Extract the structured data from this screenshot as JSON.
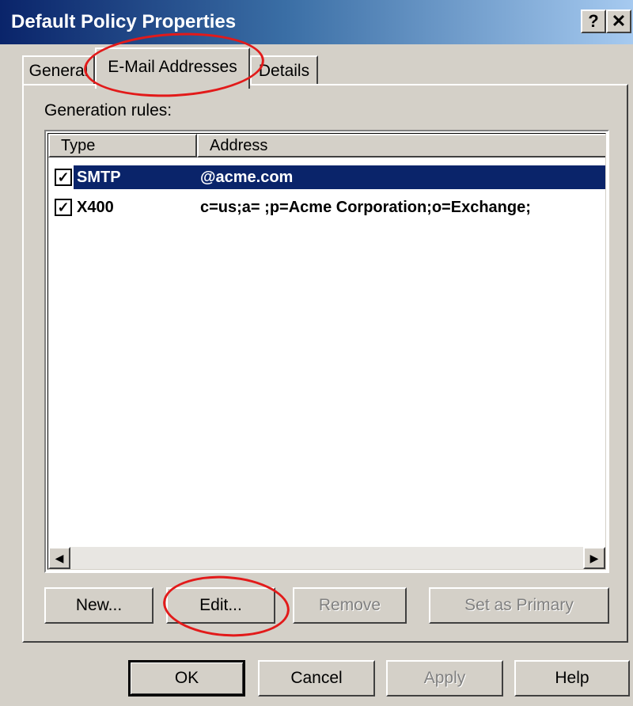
{
  "window": {
    "title": "Default Policy Properties",
    "help_label": "?",
    "close_label": "✕"
  },
  "tabs": [
    {
      "label": "General"
    },
    {
      "label": "E-Mail Addresses"
    },
    {
      "label": "Details"
    }
  ],
  "panel": {
    "generation_rules_label": "Generation rules:"
  },
  "list": {
    "columns": [
      "Type",
      "Address"
    ],
    "rows": [
      {
        "checked": true,
        "type": "SMTP",
        "address": "@acme.com",
        "selected": true
      },
      {
        "checked": true,
        "type": "X400",
        "address": "c=us;a= ;p=Acme Corporation;o=Exchange;",
        "selected": false
      }
    ],
    "checkmark": "✓",
    "scroll_left": "◀",
    "scroll_right": "▶"
  },
  "rule_buttons": {
    "new": "New...",
    "edit": "Edit...",
    "remove": "Remove",
    "set_primary": "Set as Primary"
  },
  "dialog_buttons": {
    "ok": "OK",
    "cancel": "Cancel",
    "apply": "Apply",
    "help": "Help"
  },
  "colors": {
    "title_bar": "#0a246a",
    "selection": "#0a246a",
    "face": "#d4d0c8",
    "annotation": "#e21a1a"
  }
}
